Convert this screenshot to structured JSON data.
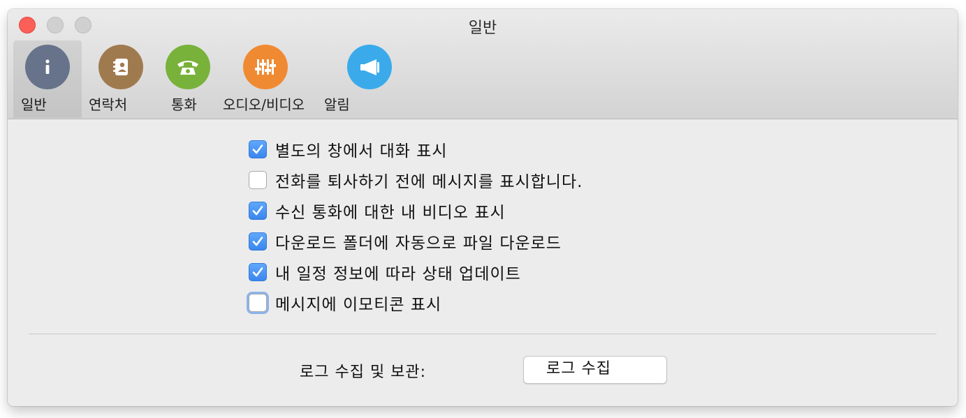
{
  "window": {
    "title": "일반"
  },
  "toolbar": {
    "tabs": [
      {
        "label": "일반",
        "icon": "info-icon",
        "color": "#66738a",
        "selected": true
      },
      {
        "label": "연락처",
        "icon": "contacts-book-icon",
        "color": "#a07a4f",
        "selected": false
      },
      {
        "label": "통화",
        "icon": "telephone-icon",
        "color": "#78b23a",
        "selected": false
      },
      {
        "label": "오디오/비디오",
        "icon": "sliders-icon",
        "color": "#f08a32",
        "selected": false
      },
      {
        "label": "알림",
        "icon": "megaphone-icon",
        "color": "#3aaaeb",
        "selected": false
      }
    ]
  },
  "options": [
    {
      "label": "별도의 창에서 대화 표시",
      "checked": true
    },
    {
      "label": "전화를 퇴사하기 전에 메시지를 표시합니다.",
      "checked": false
    },
    {
      "label": "수신 통화에 대한 내 비디오 표시",
      "checked": true
    },
    {
      "label": "다운로드 폴더에 자동으로 파일 다운로드",
      "checked": true
    },
    {
      "label": "내 일정 정보에 따라 상태 업데이트",
      "checked": true
    },
    {
      "label": "메시지에 이모티콘 표시",
      "checked": false
    }
  ],
  "logs": {
    "label": "로그 수집 및 보관:",
    "button_label": "로그 수집"
  },
  "colors": {
    "checkbox_accent": "#3a86ee",
    "close_button": "#fb5f57"
  }
}
